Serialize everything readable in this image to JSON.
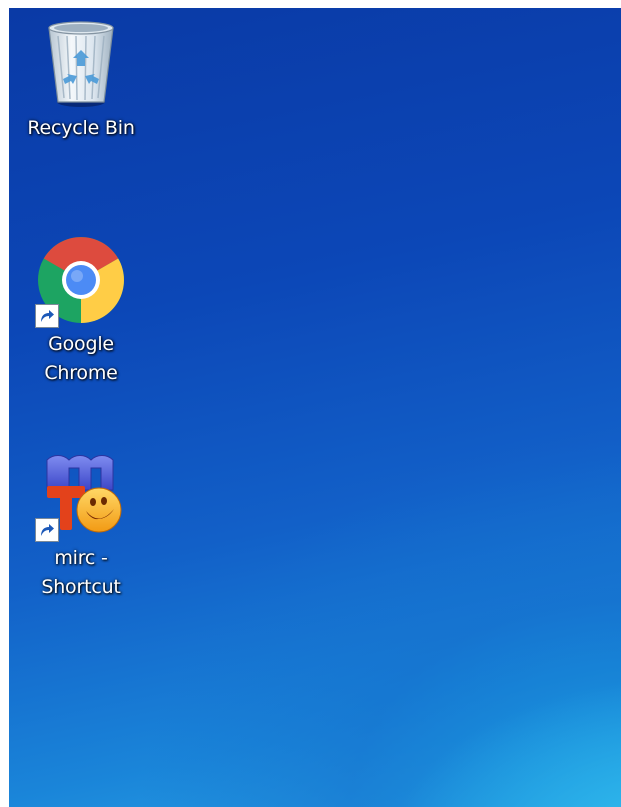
{
  "desktop": {
    "icons": [
      {
        "label_lines": [
          "Recycle Bin"
        ],
        "icon": "recycle-bin-icon",
        "shortcut": false
      },
      {
        "label_lines": [
          "Google",
          "Chrome"
        ],
        "icon": "chrome-icon",
        "shortcut": true
      },
      {
        "label_lines": [
          "mirc -",
          "Shortcut"
        ],
        "icon": "mirc-icon",
        "shortcut": true
      }
    ]
  }
}
